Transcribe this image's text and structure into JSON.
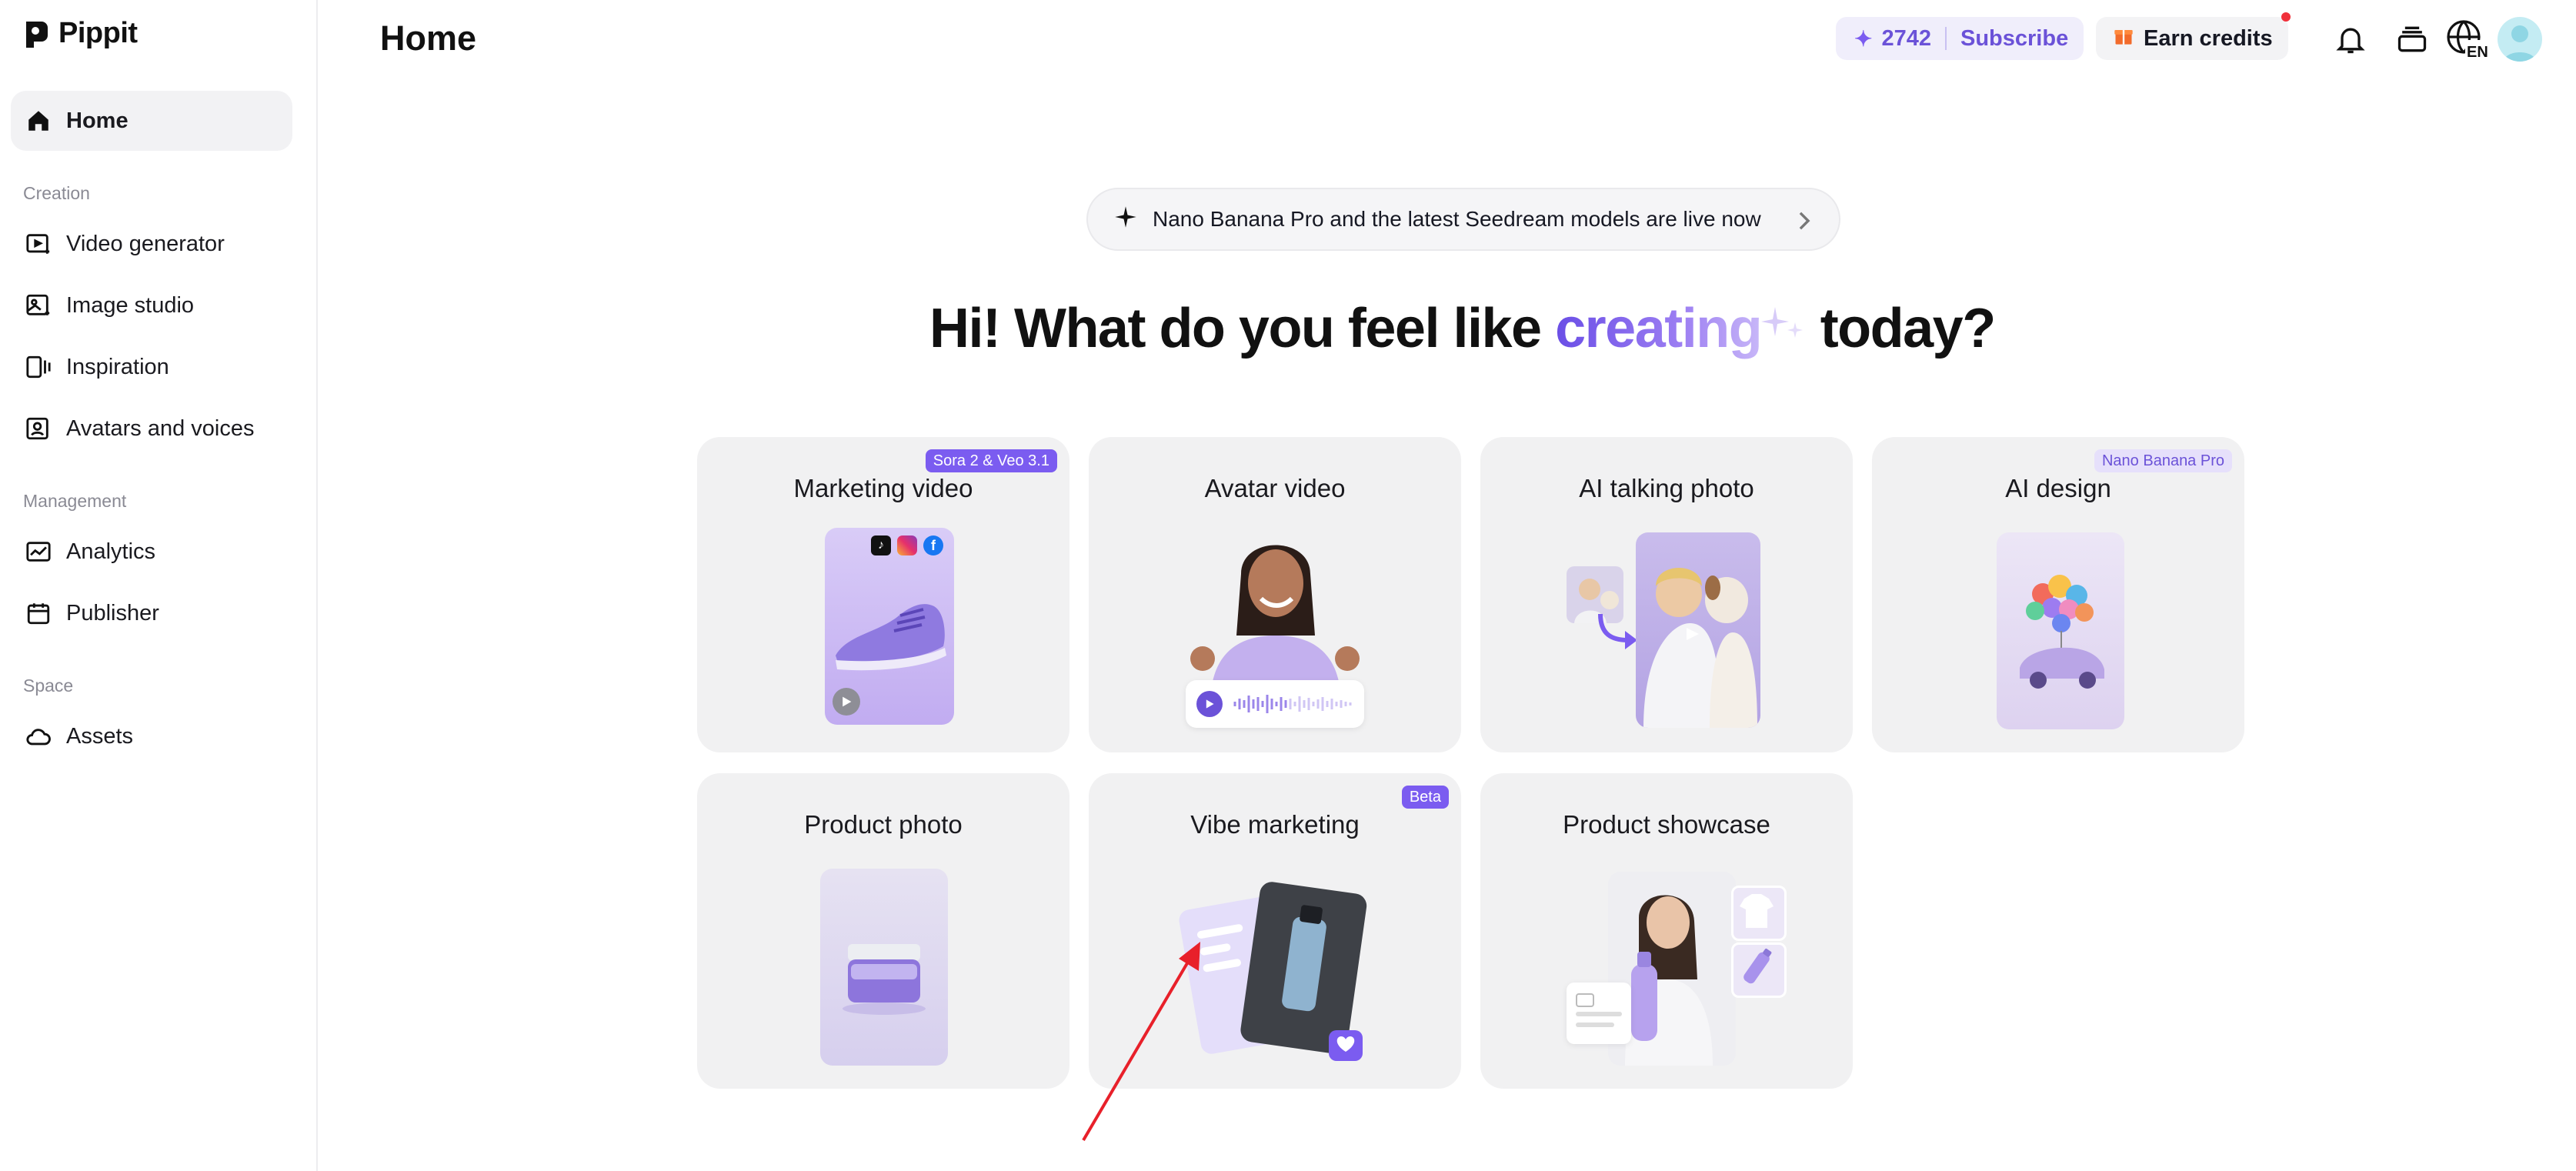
{
  "app": {
    "name": "Pippit"
  },
  "sidebar": {
    "home": "Home",
    "sections": [
      {
        "label": "Creation",
        "items": [
          "Video generator",
          "Image studio",
          "Inspiration",
          "Avatars and voices"
        ]
      },
      {
        "label": "Management",
        "items": [
          "Analytics",
          "Publisher"
        ]
      },
      {
        "label": "Space",
        "items": [
          "Assets"
        ]
      }
    ]
  },
  "header": {
    "title": "Home",
    "credits": "2742",
    "subscribe": "Subscribe",
    "earn": "Earn credits",
    "language": "EN"
  },
  "announcement": "Nano Banana Pro and the latest Seedream models are live now",
  "hero": {
    "before": "Hi! What do you feel like ",
    "accent": "creating",
    "after": " today?"
  },
  "cards": [
    {
      "title": "Marketing video",
      "badge": "Sora 2 & Veo 3.1"
    },
    {
      "title": "Avatar video"
    },
    {
      "title": "AI talking photo"
    },
    {
      "title": "AI design",
      "badge": "Nano Banana Pro"
    },
    {
      "title": "Product photo"
    },
    {
      "title": "Vibe marketing",
      "badge": "Beta"
    },
    {
      "title": "Product showcase"
    }
  ],
  "colors": {
    "accent": "#7b5cf0",
    "annotation_arrow": "#e8202a"
  }
}
